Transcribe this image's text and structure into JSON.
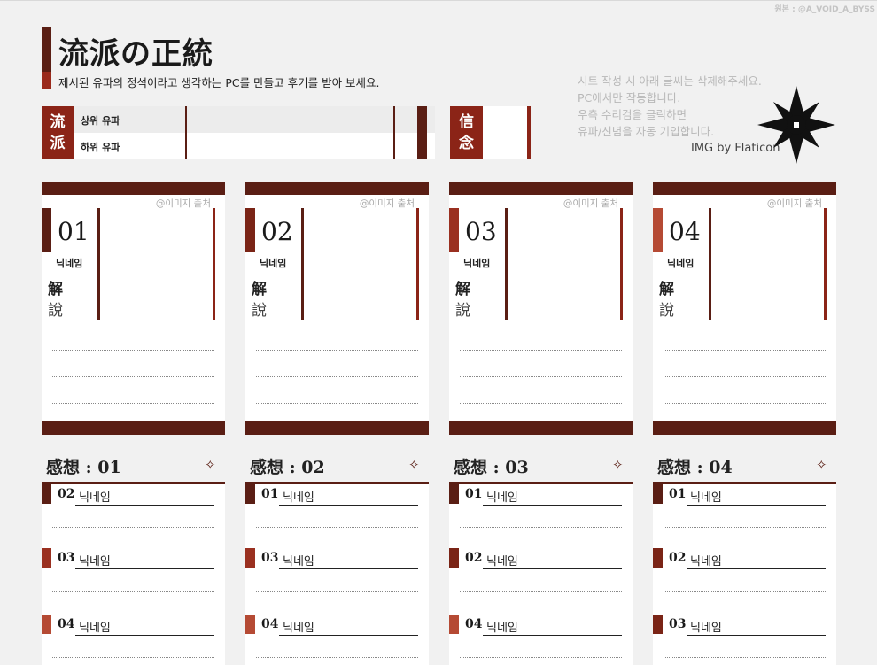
{
  "credit_top": "원본 : @A_VOID_A_BYSS",
  "title": "流派の正統",
  "subtitle": "제시된 유파의 정석이라고 생각하는 PC를 만들고 후기를 받아 보세요.",
  "notes": [
    "시트 작성 시 아래 글씨는 삭제해주세요.",
    "PC에서만 작동합니다.",
    "우측 수리검을 클릭하면",
    "유파/신념을 자동 기입합니다."
  ],
  "img_credit": "IMG by Flaticon",
  "lineage": {
    "tag": [
      "流",
      "派"
    ],
    "upper_label": "상위 유파",
    "lower_label": "하위 유파"
  },
  "belief": {
    "tag": [
      "信",
      "念"
    ]
  },
  "image_source": "@이미지 출처",
  "cards": [
    {
      "num": "01",
      "nick": "닉네임",
      "k1": "解",
      "k2": "說"
    },
    {
      "num": "02",
      "nick": "닉네임",
      "k1": "解",
      "k2": "說"
    },
    {
      "num": "03",
      "nick": "닉네임",
      "k1": "解",
      "k2": "說"
    },
    {
      "num": "04",
      "nick": "닉네임",
      "k1": "解",
      "k2": "說"
    }
  ],
  "reviews": [
    {
      "title": "感想 : 01",
      "entries": [
        {
          "num": "02",
          "nick": "닉네임"
        },
        {
          "num": "03",
          "nick": "닉네임"
        },
        {
          "num": "04",
          "nick": "닉네임"
        }
      ]
    },
    {
      "title": "感想 : 02",
      "entries": [
        {
          "num": "01",
          "nick": "닉네임"
        },
        {
          "num": "03",
          "nick": "닉네임"
        },
        {
          "num": "04",
          "nick": "닉네임"
        }
      ]
    },
    {
      "title": "感想 : 03",
      "entries": [
        {
          "num": "01",
          "nick": "닉네임"
        },
        {
          "num": "02",
          "nick": "닉네임"
        },
        {
          "num": "04",
          "nick": "닉네임"
        }
      ]
    },
    {
      "title": "感想 : 04",
      "entries": [
        {
          "num": "01",
          "nick": "닉네임"
        },
        {
          "num": "02",
          "nick": "닉네임"
        },
        {
          "num": "03",
          "nick": "닉네임"
        }
      ]
    }
  ],
  "star_glyph": "✧",
  "colors": {
    "dark": "#5a1e14",
    "accent": "#8b2417"
  }
}
